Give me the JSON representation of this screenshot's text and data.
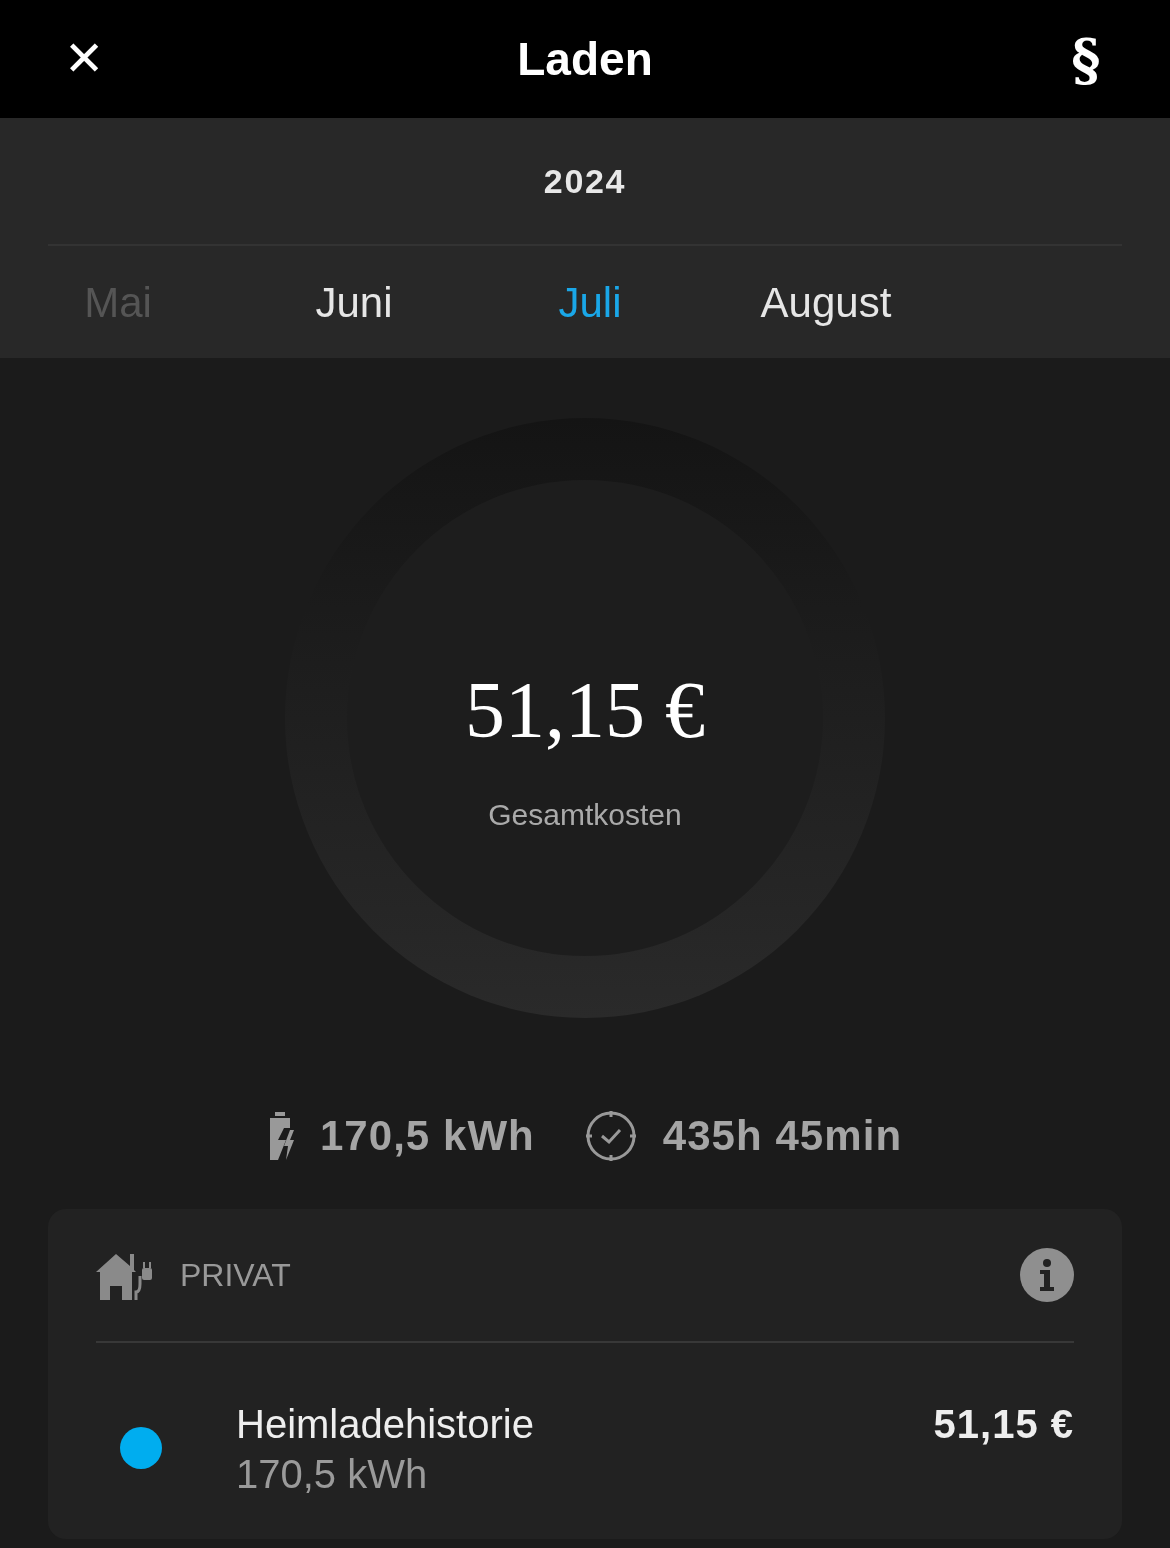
{
  "header": {
    "close": "✕",
    "title": "Laden",
    "legal": "§"
  },
  "year": "2024",
  "months": [
    {
      "label": "Mai",
      "selected": false,
      "disabled": true
    },
    {
      "label": "Juni",
      "selected": false,
      "disabled": false
    },
    {
      "label": "Juli",
      "selected": true,
      "disabled": false
    },
    {
      "label": "August",
      "selected": false,
      "disabled": false
    }
  ],
  "total": {
    "amount": "51,15 €",
    "label": "Gesamtkosten"
  },
  "stats": [
    {
      "kind": "energy",
      "value": "170,5 kWh"
    },
    {
      "kind": "duration",
      "value": "435h 45min"
    }
  ],
  "card": {
    "title": "PRIVAT",
    "entries": [
      {
        "name": "Heimladehistorie",
        "energy": "170,5 kWh",
        "cost": "51,15 €",
        "color": "#00adef"
      }
    ]
  }
}
